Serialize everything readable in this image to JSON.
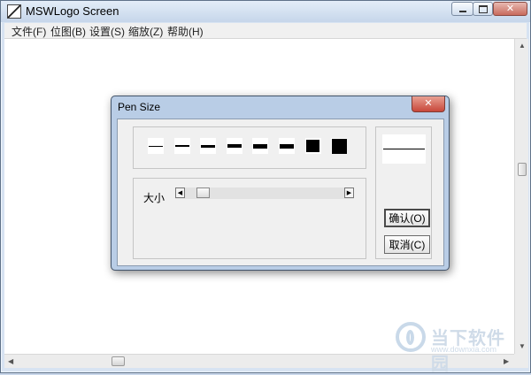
{
  "window": {
    "title": "MSWLogo Screen",
    "icon": "mswlogo-app-icon"
  },
  "menu": [
    "文件(F)",
    "位图(B)",
    "设置(S)",
    "缩放(Z)",
    "帮助(H)"
  ],
  "dialog": {
    "title": "Pen Size",
    "pen_sizes": [
      1,
      2,
      3,
      4,
      5,
      6,
      7,
      8
    ],
    "size_label": "大小",
    "slider_value_fraction": 0.08,
    "ok_label": "确认(O)",
    "cancel_label": "取消(C)"
  },
  "watermark": {
    "text": "当下软件园",
    "url": "www.downxia.com"
  },
  "colors": {
    "titlebar": "#d7e3f2",
    "close_red": "#c8473a",
    "dialog_frame": "#b9cde6"
  }
}
